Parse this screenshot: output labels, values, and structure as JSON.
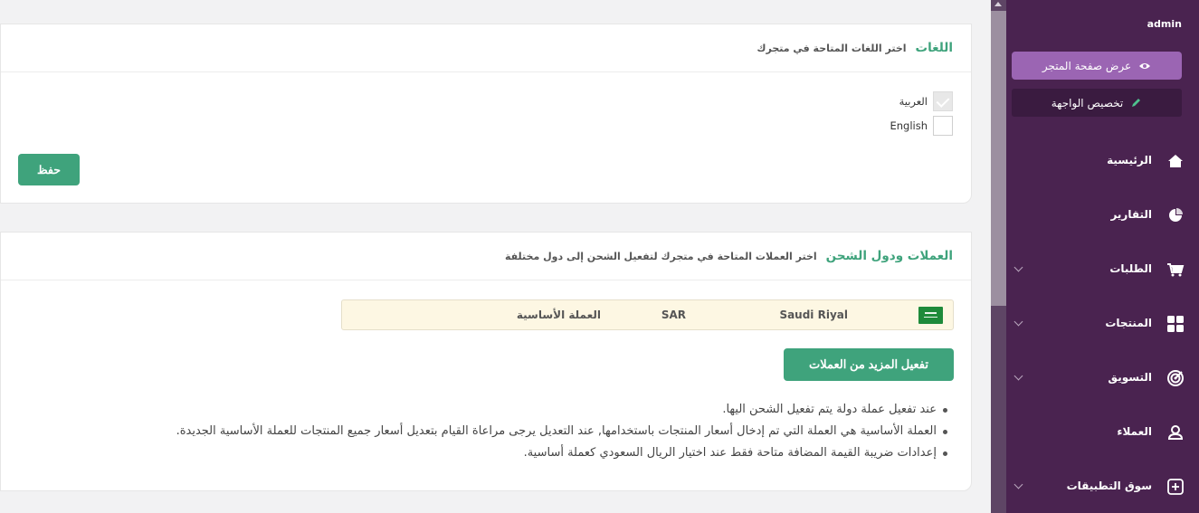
{
  "languages": {
    "title": "اللغات",
    "subtitle": "اختر اللغات المتاحة في متجرك",
    "options": [
      {
        "label": "العربية",
        "checked": true
      },
      {
        "label": "English",
        "checked": false
      }
    ],
    "save_label": "حفظ"
  },
  "currencies": {
    "title": "العملات ودول الشحن",
    "subtitle": "اختر العملات المتاحة في متجرك لتفعيل الشحن إلى دول مختلفة",
    "rows": [
      {
        "name": "Saudi Riyal",
        "code": "SAR",
        "base_label": "العملة الأساسية"
      }
    ],
    "activate_more_label": "تفعيل المزيد من العملات",
    "notes": [
      "عند تفعيل عملة دولة يتم تفعيل الشحن اليها.",
      "العملة الأساسية هي العملة التي تم إدخال أسعار المنتجات باستخدامها, عند التعديل يرجى مراعاة القيام بتعديل أسعار جميع المنتجات للعملة الأساسية الجديدة.",
      "إعدادات ضريبة القيمة المضافة متاحة فقط عند اختيار الريال السعودي كعملة أساسية."
    ]
  },
  "sidebar": {
    "user": "admin",
    "view_store_label": "عرض صفحة المتجر",
    "customize_label": "تخصيص الواجهة",
    "items": [
      {
        "label": "الرئيسية",
        "icon": "home-icon"
      },
      {
        "label": "التقارير",
        "icon": "pie-chart-icon"
      },
      {
        "label": "الطلبات",
        "icon": "cart-icon"
      },
      {
        "label": "المنتجات",
        "icon": "grid-icon"
      },
      {
        "label": "التسويق",
        "icon": "target-icon"
      },
      {
        "label": "العملاء",
        "icon": "users-icon"
      },
      {
        "label": "سوق التطبيقات",
        "icon": "plus-square-icon"
      }
    ]
  },
  "colors": {
    "accent": "#3fa37c",
    "sidebar_bg": "#4a2350",
    "store_button": "#9b65b3"
  }
}
